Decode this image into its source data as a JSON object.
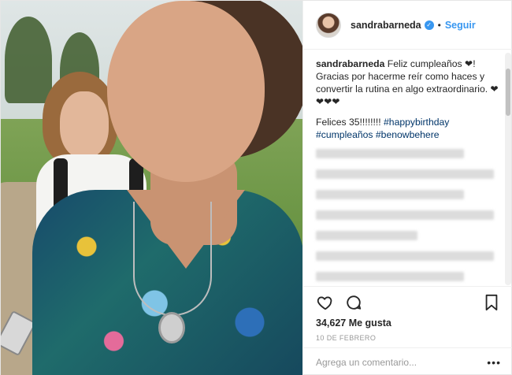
{
  "post": {
    "author": {
      "username": "sandrabarneda",
      "verified_icon": "verified-badge-icon",
      "separator": "•",
      "follow_label": "Seguir"
    },
    "caption": {
      "username": "sandrabarneda",
      "text": "Feliz cumpleaños ❤! Gracias por hacerme reír como haces y convertir la rutina en algo extraordinario. ❤❤❤❤",
      "line2_prefix": "Felices 35!!!!!!!! ",
      "hashtag1": "#happybirthday",
      "hashtag2": "#cumpleaños",
      "hashtag3": "#benowbehere"
    },
    "likes": "34,627 Me gusta",
    "date": "10 DE FEBRERO",
    "comment_placeholder": "Agrega un comentario...",
    "more_label": "•••",
    "icons": {
      "like": "heart-icon",
      "comment": "comment-icon",
      "save": "bookmark-icon"
    },
    "colors": {
      "link": "#3897f0",
      "hashtag": "#003569",
      "text": "#262626",
      "muted": "#999999"
    }
  }
}
